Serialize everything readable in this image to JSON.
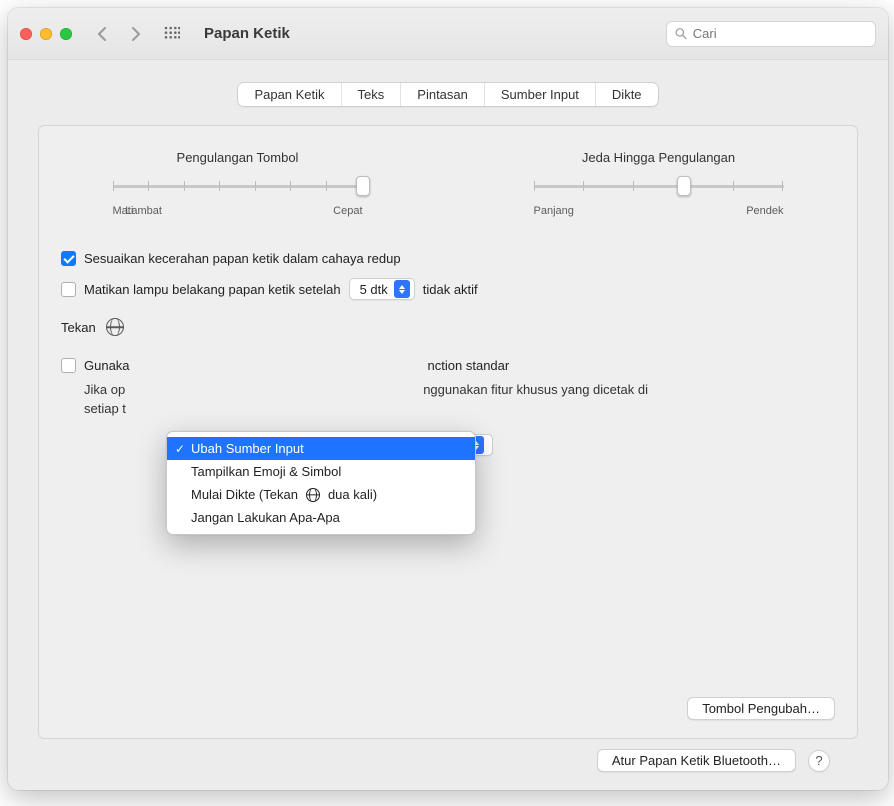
{
  "toolbar": {
    "title": "Papan Ketik",
    "search_placeholder": "Cari"
  },
  "tabs": [
    {
      "label": "Papan Ketik",
      "active": true
    },
    {
      "label": "Teks",
      "active": false
    },
    {
      "label": "Pintasan",
      "active": false
    },
    {
      "label": "Sumber Input",
      "active": false
    },
    {
      "label": "Dikte",
      "active": false
    }
  ],
  "sliders": {
    "keyRepeat": {
      "title": "Pengulangan Tombol",
      "leftLabel": "Mati",
      "midLabel": "Lambat",
      "rightLabel": "Cepat",
      "tickCount": 8,
      "valueIndex": 7
    },
    "delay": {
      "title": "Jeda Hingga Pengulangan",
      "leftLabel": "Panjang",
      "rightLabel": "Pendek",
      "tickCount": 6,
      "valueIndex": 3
    }
  },
  "options": {
    "adjustBrightness": {
      "checked": true,
      "label": "Sesuaikan kecerahan papan ketik dalam cahaya redup"
    },
    "turnOffBacklight": {
      "checked": false,
      "labelPrefix": "Matikan lampu belakang papan ketik setelah",
      "duration": "5 dtk",
      "labelSuffix": "tidak aktif"
    },
    "pressGlobe": {
      "label": "Tekan",
      "menu": {
        "items": [
          {
            "label": "Ubah Sumber Input",
            "selected": true,
            "hasGlobe": false
          },
          {
            "label": "Tampilkan Emoji & Simbol",
            "selected": false,
            "hasGlobe": false
          },
          {
            "labelPrefix": "Mulai Dikte (Tekan",
            "labelSuffix": "dua kali)",
            "selected": false,
            "hasGlobe": true
          },
          {
            "label": "Jangan Lakukan Apa-Apa",
            "selected": false,
            "hasGlobe": false
          }
        ]
      }
    },
    "useFnKeys": {
      "checked": false,
      "labelVisibleStart": "Gunaka",
      "labelVisibleEnd": "nction standar",
      "noteVisibleStart": "Jika op",
      "noteVisibleMid": "nggunakan fitur khusus yang dicetak di",
      "noteLine2Start": "setiap t"
    }
  },
  "buttons": {
    "modifierKeys": "Tombol Pengubah…",
    "bluetoothKeyboard": "Atur Papan Ketik Bluetooth…",
    "help": "?"
  }
}
